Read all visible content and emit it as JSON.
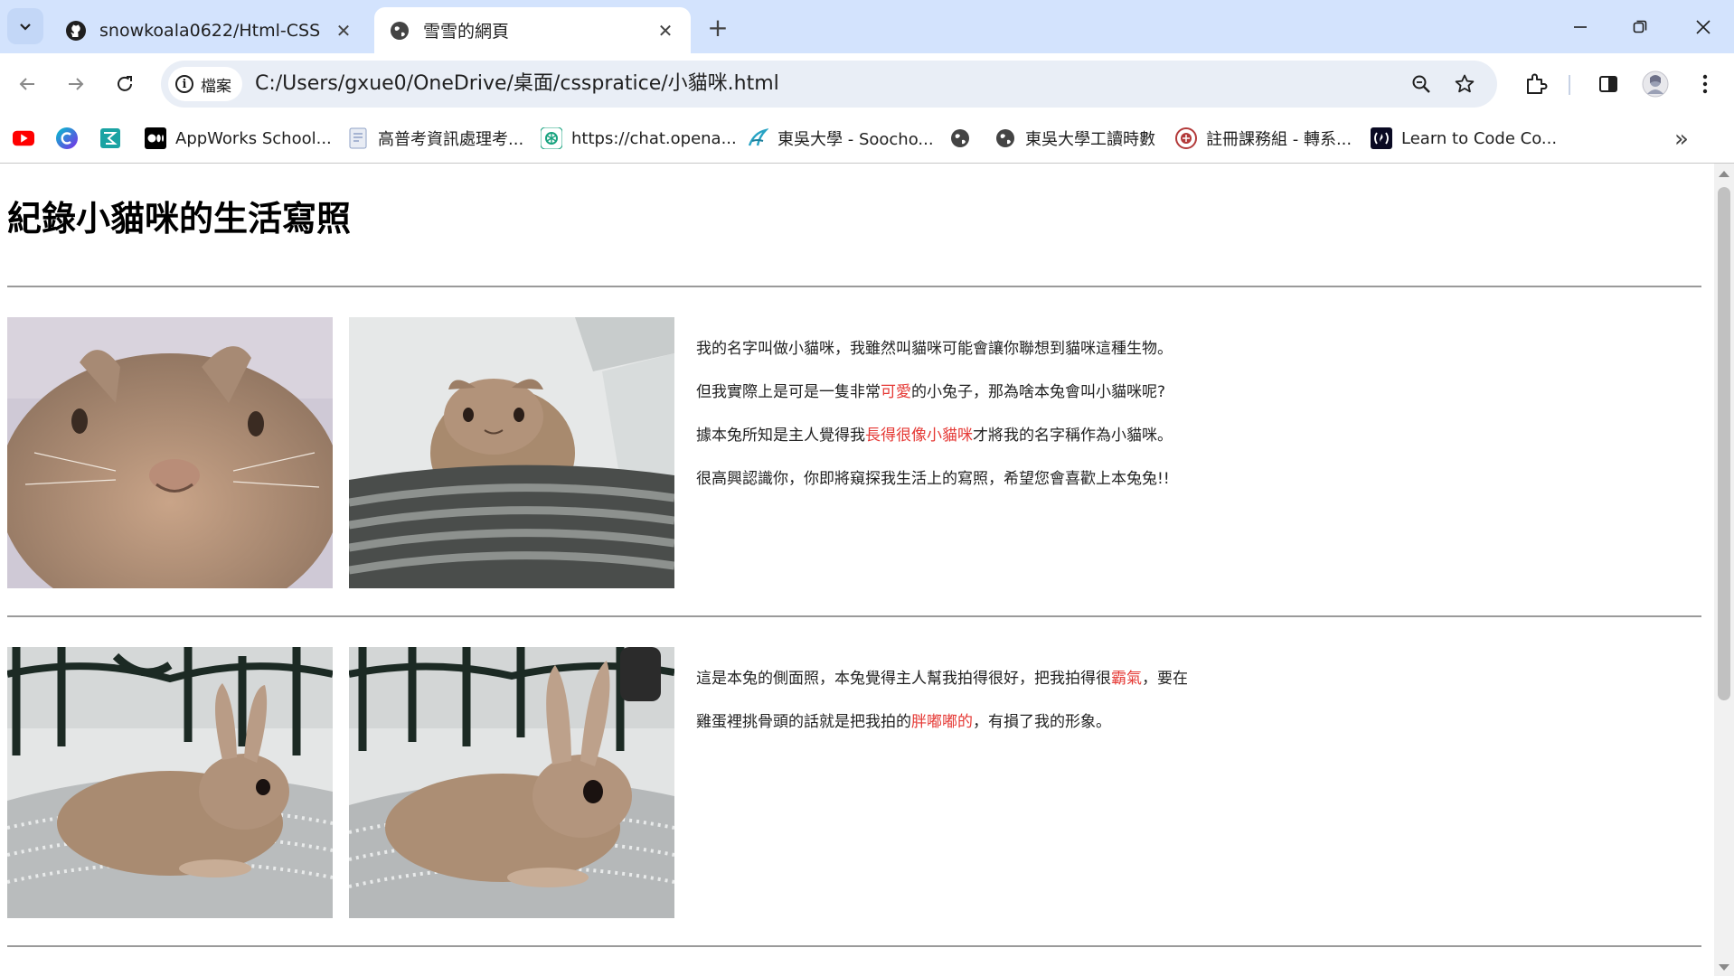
{
  "browser": {
    "tabs": [
      {
        "title": "snowkoala0622/Html-CSS",
        "icon": "github-icon",
        "active": false
      },
      {
        "title": "雪雪的網頁",
        "icon": "globe-icon",
        "active": true
      }
    ],
    "address": {
      "security_chip": "檔案",
      "url": "C:/Users/gxue0/OneDrive/桌面/csspratice/小貓咪.html"
    },
    "bookmarks": [
      {
        "label": "",
        "icon": "youtube-icon"
      },
      {
        "label": "",
        "icon": "canva-icon"
      },
      {
        "label": "",
        "icon": "bookmark-app-icon"
      },
      {
        "label": "AppWorks School...",
        "icon": "medium-icon"
      },
      {
        "label": "高普考資訊處理考...",
        "icon": "document-icon"
      },
      {
        "label": "https://chat.opena...",
        "icon": "openai-icon"
      },
      {
        "label": "東吳大學 - Soocho...",
        "icon": "soochow-icon"
      },
      {
        "label": "",
        "icon": "globe-icon"
      },
      {
        "label": "東吳大學工讀時數",
        "icon": "globe-icon"
      },
      {
        "label": "註冊課務組 - 轉系...",
        "icon": "seal-icon"
      },
      {
        "label": "Learn to Code  Co...",
        "icon": "freecodecamp-icon"
      }
    ]
  },
  "page": {
    "title": "紀錄小貓咪的生活寫照",
    "section1": {
      "lines": [
        {
          "parts": [
            {
              "t": "我的名字叫做小貓咪，我雖然叫貓咪可能會讓你聯想到貓咪這種生物。",
              "hl": false
            }
          ]
        },
        {
          "parts": [
            {
              "t": "但我實際上是可是一隻非常",
              "hl": false
            },
            {
              "t": "可愛",
              "hl": true
            },
            {
              "t": "的小兔子，那為啥本兔會叫小貓咪呢?",
              "hl": false
            }
          ]
        },
        {
          "parts": [
            {
              "t": "據本兔所知是主人覺得我",
              "hl": false
            },
            {
              "t": "長得很像小貓咪",
              "hl": true
            },
            {
              "t": "才將我的名字稱作為小貓咪。",
              "hl": false
            }
          ]
        },
        {
          "parts": [
            {
              "t": "很高興認識你，你即將窺探我生活上的寫照，希望您會喜歡上本兔兔!!",
              "hl": false
            }
          ]
        }
      ]
    },
    "section2": {
      "lines": [
        {
          "parts": [
            {
              "t": "這是本兔的側面照，本兔覺得主人幫我拍得很好，把我拍得很",
              "hl": false
            },
            {
              "t": "霸氣",
              "hl": true
            },
            {
              "t": "，要在",
              "hl": false
            }
          ]
        },
        {
          "parts": [
            {
              "t": "雞蛋裡挑骨頭的話就是把我拍的",
              "hl": false
            },
            {
              "t": "胖嘟嘟的",
              "hl": true
            },
            {
              "t": "，有損了我的形象。",
              "hl": false
            }
          ]
        }
      ]
    }
  },
  "colors": {
    "accent_red": "#e53935",
    "tab_strip": "#d3e3fd",
    "omnibox": "#e9eef6"
  }
}
